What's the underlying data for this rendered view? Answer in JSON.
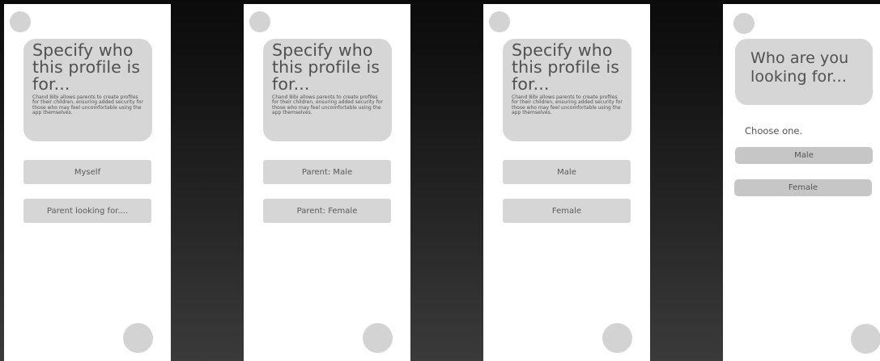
{
  "screens": [
    {
      "title": "Specify who this profile is for...",
      "description": "Chand Bibi allows parents to create profiles for their children, ensuring added security for those who may feel uncomfortable using the app themselves.",
      "options": [
        "Myself",
        "Parent looking for...."
      ]
    },
    {
      "title": "Specify who this profile is for...",
      "description": "Chand Bibi allows parents to create profiles for their children, ensuring added security for those who may feel uncomfortable using the app themselves.",
      "options": [
        "Parent: Male",
        "Parent: Female"
      ]
    },
    {
      "title": "Specify who this profile is for...",
      "description": "Chand Bibi allows parents to create profiles for their children, ensuring added security for those who may feel uncomfortable using the app themselves.",
      "options": [
        "Male",
        "Female"
      ]
    },
    {
      "title": "Who are you looking for...",
      "instruction": "Choose one.",
      "options": [
        "Male",
        "Female"
      ]
    }
  ],
  "colors": {
    "panel": "#d6d6d6",
    "button_dark": "#c6c6c6",
    "text": "#505050"
  }
}
